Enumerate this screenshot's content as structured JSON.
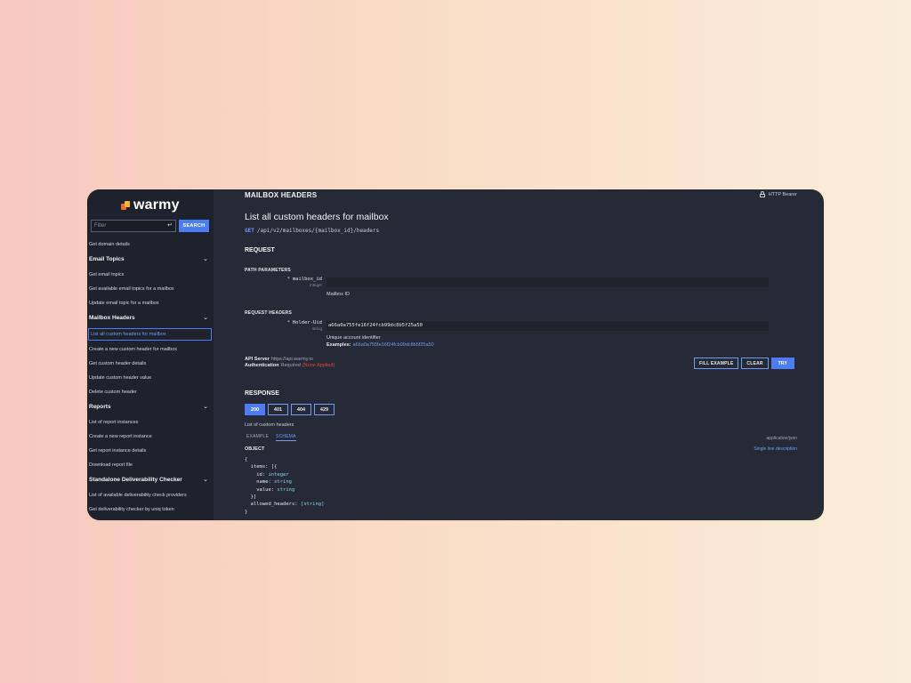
{
  "brand": {
    "name": "warmy"
  },
  "sidebar": {
    "filter_placeholder": "Filter",
    "search_label": "SEARCH",
    "items": [
      {
        "type": "item",
        "label": "Get domain details"
      },
      {
        "type": "group",
        "label": "Email Topics"
      },
      {
        "type": "item",
        "label": "Get email topics"
      },
      {
        "type": "item",
        "label": "Get available email topics for a mailbox"
      },
      {
        "type": "item",
        "label": "Update email topic for a mailbox"
      },
      {
        "type": "group",
        "label": "Mailbox Headers"
      },
      {
        "type": "item",
        "label": "List all custom headers for mailbox",
        "active": true
      },
      {
        "type": "item",
        "label": "Create a new custom header for mailbox"
      },
      {
        "type": "item",
        "label": "Get custom header details"
      },
      {
        "type": "item",
        "label": "Update custom header value"
      },
      {
        "type": "item",
        "label": "Delete custom header"
      },
      {
        "type": "group",
        "label": "Reports"
      },
      {
        "type": "item",
        "label": "List of report instances"
      },
      {
        "type": "item",
        "label": "Create a new report instance"
      },
      {
        "type": "item",
        "label": "Get report instance details"
      },
      {
        "type": "item",
        "label": "Download report file"
      },
      {
        "type": "group",
        "label": "Standalone Deliverability Checker"
      },
      {
        "type": "item",
        "label": "List of available deliverability check providers"
      },
      {
        "type": "item",
        "label": "Get deliverability checker by uniq token"
      }
    ]
  },
  "header": {
    "section": "MAILBOX HEADERS",
    "auth_badge": "HTTP Bearer"
  },
  "operation": {
    "title": "List all custom headers for mailbox",
    "method": "GET",
    "path": "/api/v2/mailboxes/{mailbox_id}/headers"
  },
  "request": {
    "heading": "REQUEST",
    "path_params_heading": "PATH PARAMETERS",
    "path_param": {
      "required": "*",
      "name": "mailbox_id",
      "type": "integer",
      "value": "",
      "description": "Mailbox ID"
    },
    "headers_heading": "REQUEST HEADERS",
    "header_param": {
      "required": "*",
      "name": "Holder-Uid",
      "type": "string",
      "value": "a66a0a755fe16f24fcb99dc8b5f25a50",
      "description": "Unique account identifier",
      "examples_label": "Examples:",
      "example_value": "a66a0a755fe16f24fcb99dc8b5f25a50"
    },
    "api_server_label": "API Server",
    "api_server_value": "https://api.warmy.io",
    "authentication_label": "Authentication",
    "authentication_status": "Required",
    "authentication_note": "(None Applied)",
    "buttons": {
      "fill_example": "FILL EXAMPLE",
      "clear": "CLEAR",
      "try": "TRY"
    }
  },
  "response": {
    "heading": "RESPONSE",
    "codes": [
      "200",
      "401",
      "404",
      "429"
    ],
    "active_code": "200",
    "description": "List of custom headers",
    "tabs": {
      "example": "EXAMPLE",
      "schema": "SCHEMA"
    },
    "content_type": "application/json",
    "object_label": "OBJECT",
    "single_line_link": "Single line description",
    "schema": {
      "open": "{",
      "items_key": "  items: [{",
      "fields": [
        {
          "indent": "    ",
          "key": "id:",
          "type": "integer"
        },
        {
          "indent": "    ",
          "key": "name:",
          "type": "string"
        },
        {
          "indent": "    ",
          "key": "value:",
          "type": "string"
        }
      ],
      "items_close": "  }]",
      "allowed_key": "  allowed_headers:",
      "allowed_type": "[string]",
      "close": "}"
    }
  },
  "colors": {
    "accent": "#4d7cf4",
    "window_bg": "#262a36",
    "sidebar_bg": "#1e222c",
    "warning": "#e0463e"
  }
}
